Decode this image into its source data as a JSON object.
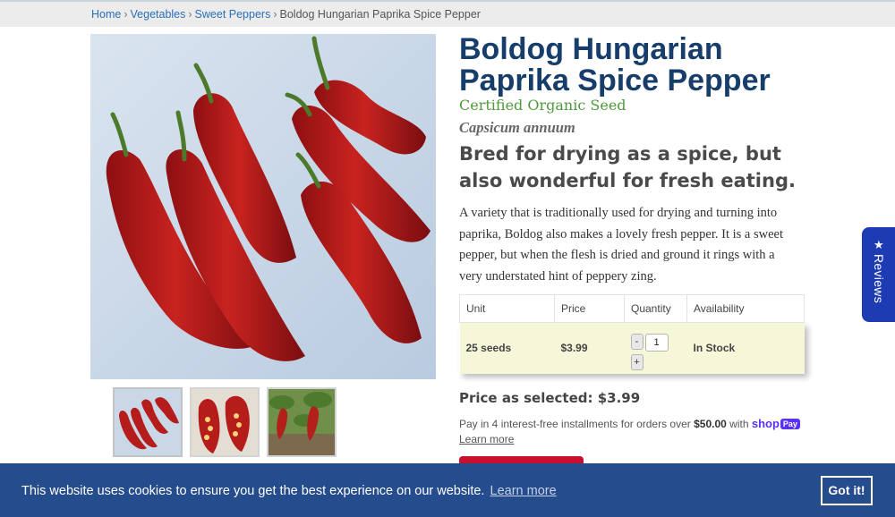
{
  "breadcrumb": {
    "home": "Home",
    "vegetables": "Vegetables",
    "category": "Sweet Peppers",
    "current": "Boldog Hungarian Paprika Spice Pepper",
    "separator": "›"
  },
  "product": {
    "title": "Boldog Hungarian Paprika Spice Pepper",
    "certification": "Certified Organic Seed",
    "latin_name": "Capsicum annuum",
    "tagline": "Bred for drying as a spice, but also wonderful for fresh eating.",
    "description": "A variety that is traditionally used for drying and turning into paprika, Boldog also makes a lovely fresh pepper. It is a sweet pepper, but when the flesh is dried and ground it rings with a very understated hint of peppery zing."
  },
  "table": {
    "headers": [
      "Unit",
      "Price",
      "Quantity",
      "Availability"
    ],
    "row": {
      "unit": "25 seeds",
      "price": "$3.99",
      "quantity": "1",
      "minus": "-",
      "plus": "+",
      "availability": "In Stock"
    }
  },
  "selection": {
    "price_text": "Price as selected: $3.99"
  },
  "installments": {
    "pre": "Pay in 4 interest-free installments for orders over",
    "amount": "$50.00",
    "mid": "with",
    "brand_shop": "shop",
    "brand_pay": "Pay",
    "learn_more": "Learn more"
  },
  "reviews_tab": {
    "label": "Reviews",
    "star": "★"
  },
  "cookie": {
    "message": "This website uses cookies to ensure you get the best experience on our website.",
    "learn_more": "Learn more",
    "button": "Got it!"
  },
  "colors": {
    "title": "#173d6b",
    "organic_green": "#4f9a3a",
    "cookie_bg": "#254c8c",
    "reviews_bg": "#1d3bb3",
    "cart_button": "#c8102e",
    "in_stock": "#2e8b1f",
    "shoppay": "#5a31f4"
  }
}
